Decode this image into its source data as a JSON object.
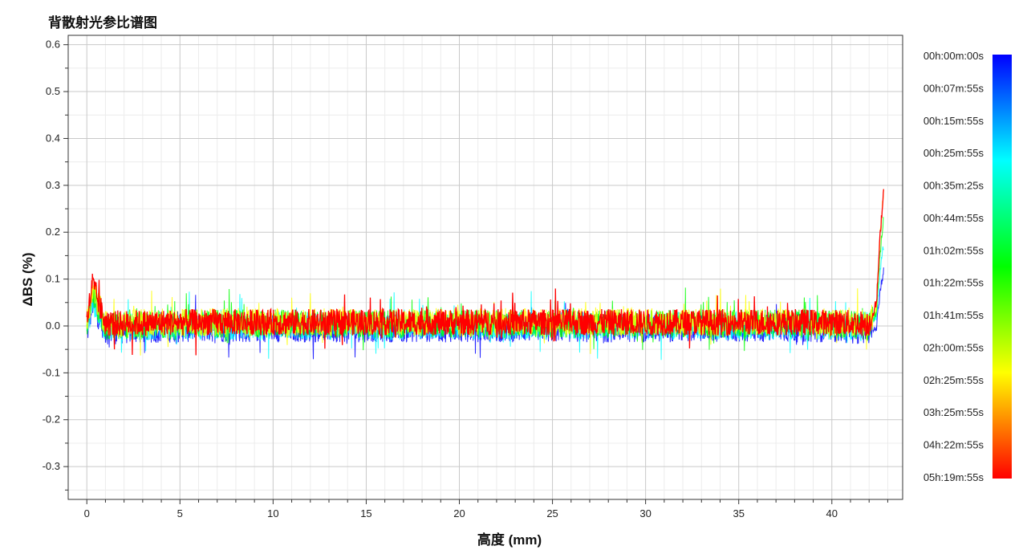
{
  "chart_data": {
    "type": "line",
    "title": "背散射光参比谱图",
    "xlabel": "高度 (mm)",
    "ylabel": "ΔBS (%)",
    "xlim": [
      -1,
      43.8
    ],
    "ylim": [
      -0.37,
      0.62
    ],
    "xticks": [
      0,
      5,
      10,
      15,
      20,
      25,
      30,
      35,
      40
    ],
    "yticks": [
      -0.3,
      -0.2,
      -0.1,
      0.0,
      0.1,
      0.2,
      0.3,
      0.4,
      0.5,
      0.6
    ],
    "x_tick_labels": [
      "0",
      "5",
      "10",
      "15",
      "20",
      "25",
      "30",
      "35",
      "40"
    ],
    "y_tick_labels": [
      "-0.3",
      "-0.2",
      "-0.1",
      "0.0",
      "0.1",
      "0.2",
      "0.3",
      "0.4",
      "0.5",
      "0.6"
    ],
    "grid": true,
    "legend_placement": "right",
    "colorbar": {
      "colors": [
        "#0000ff",
        "#00ffff",
        "#00ff00",
        "#ffff00",
        "#ff0000"
      ],
      "labels": [
        "00h:00m:00s",
        "00h:07m:55s",
        "00h:15m:55s",
        "00h:25m:55s",
        "00h:35m:25s",
        "00h:44m:55s",
        "01h:02m:55s",
        "01h:22m:55s",
        "01h:41m:55s",
        "02h:00m:55s",
        "02h:25m:55s",
        "03h:25m:55s",
        "04h:22m:55s",
        "05h:19m:55s"
      ]
    },
    "series": [
      {
        "color": "#0000ff",
        "x": [
          0,
          0.3,
          1,
          5,
          10,
          15,
          20,
          25,
          30,
          35,
          40,
          42,
          42.4,
          42.6,
          42.8
        ],
        "y": [
          -0.02,
          0.05,
          -0.01,
          -0.005,
          -0.005,
          -0.005,
          -0.005,
          -0.005,
          -0.005,
          -0.005,
          -0.005,
          -0.01,
          0.0,
          0.08,
          0.12
        ]
      },
      {
        "color": "#00ffff",
        "x": [
          0,
          0.3,
          1,
          5,
          10,
          15,
          20,
          25,
          30,
          35,
          40,
          42,
          42.4,
          42.6,
          42.8
        ],
        "y": [
          -0.01,
          0.06,
          -0.005,
          0.0,
          0.0,
          0.0,
          0.0,
          0.0,
          0.0,
          0.0,
          0.0,
          0.0,
          0.02,
          0.12,
          0.18
        ]
      },
      {
        "color": "#00ff00",
        "x": [
          0,
          0.3,
          1,
          5,
          10,
          15,
          20,
          25,
          30,
          35,
          40,
          42,
          42.4,
          42.6,
          42.8
        ],
        "y": [
          0.0,
          0.07,
          0.0,
          0.005,
          0.005,
          0.005,
          0.005,
          0.005,
          0.005,
          0.005,
          0.005,
          0.0,
          0.03,
          0.16,
          0.24
        ]
      },
      {
        "color": "#ffff00",
        "x": [
          0,
          0.3,
          1,
          5,
          10,
          15,
          20,
          25,
          30,
          35,
          40,
          42,
          42.4,
          42.6,
          42.8
        ],
        "y": [
          0.005,
          0.08,
          0.005,
          0.008,
          0.008,
          0.008,
          0.008,
          0.008,
          0.008,
          0.008,
          0.008,
          0.005,
          0.04,
          0.2,
          0.3
        ]
      },
      {
        "color": "#ff0000",
        "x": [
          0,
          0.3,
          1,
          5,
          10,
          15,
          20,
          25,
          30,
          35,
          40,
          42,
          42.4,
          42.6,
          42.8
        ],
        "y": [
          0.01,
          0.09,
          0.005,
          0.008,
          0.008,
          0.008,
          0.008,
          0.008,
          0.008,
          0.008,
          0.008,
          0.005,
          0.05,
          0.2,
          0.3
        ]
      }
    ]
  }
}
